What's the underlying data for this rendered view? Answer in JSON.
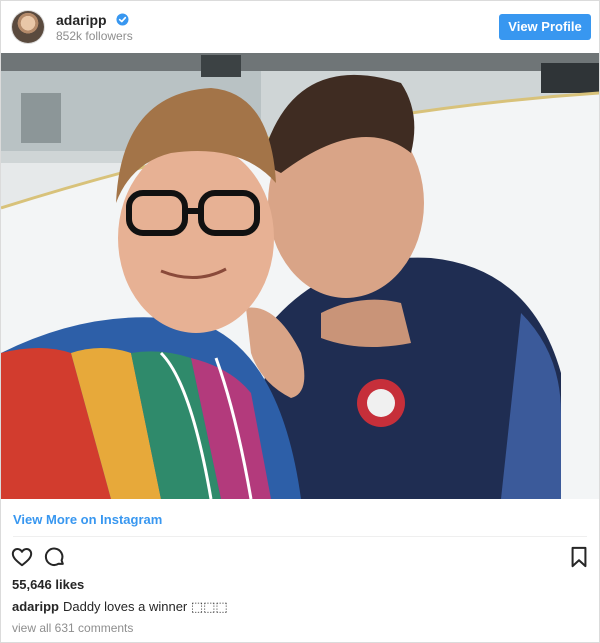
{
  "header": {
    "username": "adaripp",
    "followers": "852k followers",
    "view_profile_label": "View Profile",
    "verified_icon": "verified-badge-icon",
    "accent_color": "#3897f0"
  },
  "photo": {
    "alt": "Selfie of two men at an ice rink"
  },
  "footer": {
    "view_more_label": "View More on Instagram",
    "likes": "55,646 likes",
    "caption_user": "adaripp",
    "caption_text": "Daddy loves a winner ⬚⬚⬚",
    "comments_link": "view all 631 comments",
    "icons": [
      "heart-icon",
      "comment-icon",
      "bookmark-icon"
    ]
  }
}
